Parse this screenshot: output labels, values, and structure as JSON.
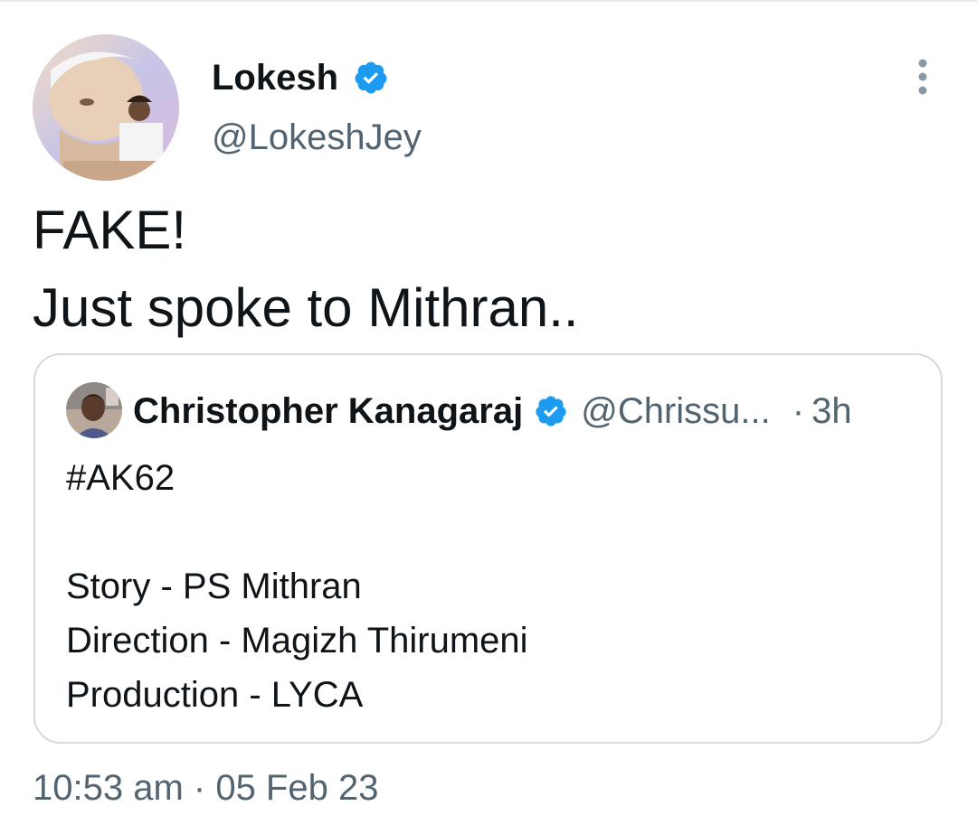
{
  "tweet": {
    "author": {
      "name": "Lokesh",
      "handle": "@LokeshJey",
      "verified": true
    },
    "text_lines": [
      "FAKE!",
      "Just spoke to Mithran.."
    ],
    "timestamp": "10:53 am · 05 Feb 23"
  },
  "quoted_tweet": {
    "author": {
      "name": "Christopher Kanagaraj",
      "handle": "@Chrissu...",
      "verified": true
    },
    "separator": "·",
    "age": "3h",
    "lines": [
      "#AK62",
      "",
      "Story - PS Mithran",
      "Direction - Magizh Thirumeni",
      "Production - LYCA"
    ]
  },
  "icons": {
    "verified": "verified-badge-icon",
    "more": "more-options-icon"
  },
  "colors": {
    "verified": "#1d9bf0",
    "text_primary": "#0f1419",
    "text_secondary": "#536471",
    "border": "#d6dadd"
  }
}
